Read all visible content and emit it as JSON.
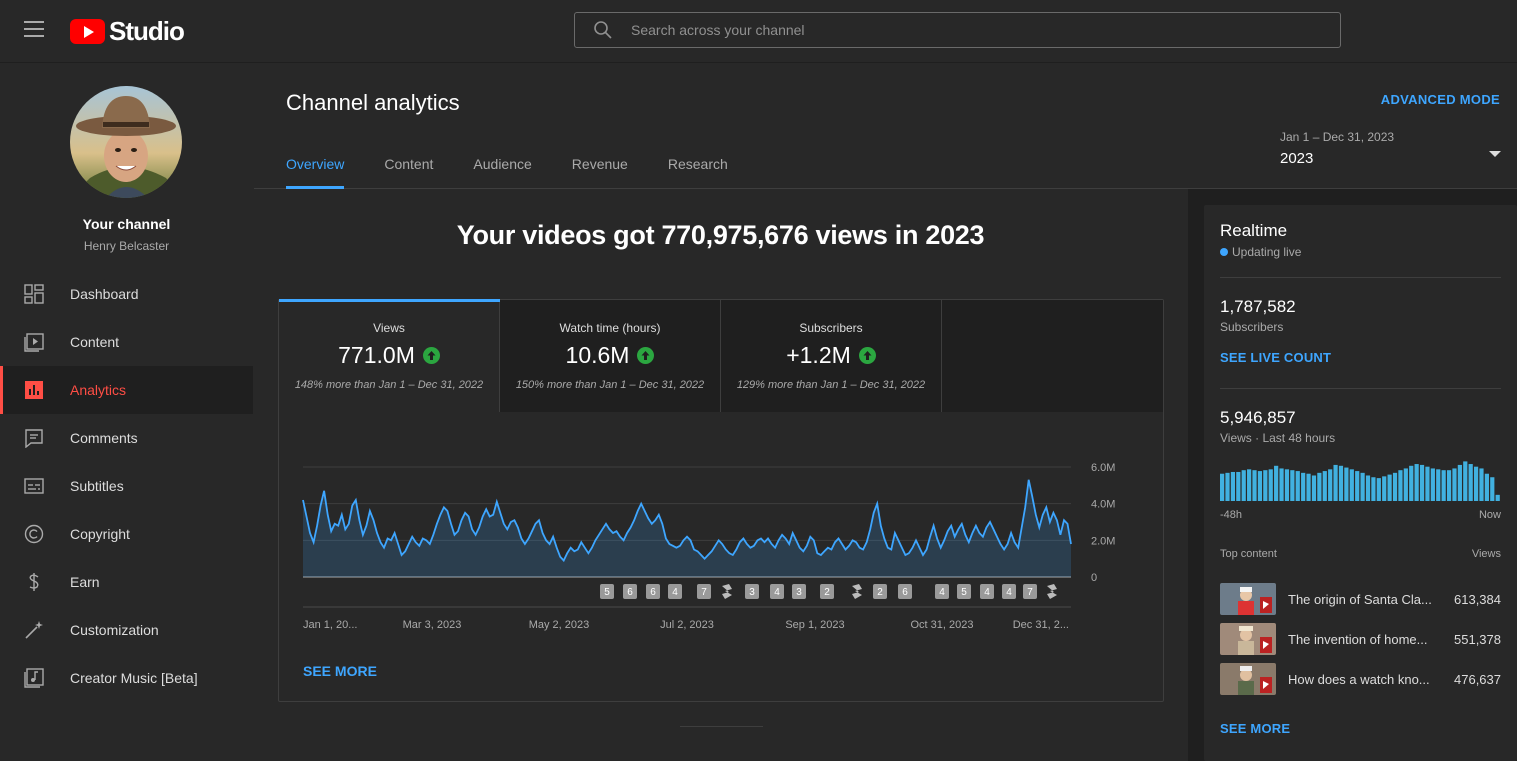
{
  "app": {
    "logo_text": "Studio",
    "brand_color": "#ff0000",
    "accent": "#3ea6ff"
  },
  "search": {
    "placeholder": "Search across your channel"
  },
  "channel": {
    "title": "Your channel",
    "name": "Henry Belcaster"
  },
  "sidebar": {
    "items": [
      {
        "label": "Dashboard",
        "icon": "dashboard-icon"
      },
      {
        "label": "Content",
        "icon": "content-icon"
      },
      {
        "label": "Analytics",
        "icon": "analytics-icon",
        "active": true
      },
      {
        "label": "Comments",
        "icon": "comments-icon"
      },
      {
        "label": "Subtitles",
        "icon": "subtitles-icon"
      },
      {
        "label": "Copyright",
        "icon": "copyright-icon"
      },
      {
        "label": "Earn",
        "icon": "dollar-icon"
      },
      {
        "label": "Customization",
        "icon": "magic-wand-icon"
      },
      {
        "label": "Creator Music [Beta]",
        "icon": "music-icon"
      }
    ]
  },
  "header": {
    "title": "Channel analytics",
    "advanced_mode": "ADVANCED MODE",
    "tabs": [
      "Overview",
      "Content",
      "Audience",
      "Revenue",
      "Research"
    ],
    "active_tab": "Overview",
    "date_range": "Jan 1 – Dec 31, 2023",
    "date_value": "2023"
  },
  "headline": "Your videos got 770,975,676 views in 2023",
  "metrics": [
    {
      "label": "Views",
      "value": "771.0M",
      "comparison": "148% more than Jan 1 – Dec 31, 2022"
    },
    {
      "label": "Watch time (hours)",
      "value": "10.6M",
      "comparison": "150% more than Jan 1 – Dec 31, 2022"
    },
    {
      "label": "Subscribers",
      "value": "+1.2M",
      "comparison": "129% more than Jan 1 – Dec 31, 2022"
    }
  ],
  "chart_data": {
    "type": "area",
    "title": "",
    "xlabel": "",
    "ylabel": "",
    "x_ticks": [
      "Jan 1, 20...",
      "Mar 3, 2023",
      "May 2, 2023",
      "Jul 2, 2023",
      "Sep 1, 2023",
      "Oct 31, 2023",
      "Dec 31, 2..."
    ],
    "y_ticks": [
      "6.0M",
      "4.0M",
      "2.0M",
      "0"
    ],
    "ylim": [
      0,
      6000000
    ],
    "grid": true,
    "series": [
      {
        "values_millions": [
          4.2,
          3.3,
          2.4,
          1.9,
          2.8,
          3.9,
          4.7,
          3.4,
          2.5,
          2.9,
          2.8,
          3.4,
          2.6,
          2.9,
          3.9,
          4.2,
          3.1,
          2.3,
          2.8,
          3.6,
          3.1,
          2.4,
          1.9,
          1.6,
          2.1,
          2.0,
          2.4,
          1.8,
          1.2,
          1.4,
          1.8,
          2.2,
          1.9,
          1.7,
          2.1,
          2.0,
          1.8,
          2.3,
          2.9,
          3.4,
          3.8,
          3.6,
          2.9,
          2.3,
          2.5,
          3.1,
          3.5,
          3.3,
          2.6,
          2.3,
          2.7,
          3.3,
          3.7,
          3.3,
          3.4,
          4.1,
          3.5,
          2.9,
          2.6,
          3.0,
          3.1,
          2.7,
          2.1,
          1.8,
          2.1,
          2.5,
          2.9,
          3.1,
          2.4,
          2.0,
          1.8,
          2.2,
          1.6,
          1.1,
          0.9,
          1.3,
          1.6,
          1.4,
          1.5,
          1.9,
          1.6,
          1.3,
          1.6,
          2.0,
          2.3,
          2.6,
          2.9,
          2.6,
          2.4,
          2.5,
          2.2,
          2.0,
          2.4,
          2.7,
          3.1,
          3.6,
          4.0,
          3.6,
          3.2,
          2.9,
          3.1,
          3.4,
          2.9,
          2.1,
          1.8,
          1.7,
          1.6,
          1.7,
          2.0,
          2.2,
          2.0,
          1.5,
          1.4,
          1.2,
          1.0,
          1.2,
          1.4,
          1.7,
          2.0,
          1.8,
          1.5,
          1.3,
          1.2,
          1.5,
          1.9,
          2.1,
          1.8,
          1.6,
          1.7,
          2.0,
          2.1,
          1.9,
          2.1,
          1.8,
          1.6,
          2.0,
          2.3,
          2.1,
          1.8,
          2.4,
          2.0,
          1.6,
          1.4,
          1.7,
          2.2,
          2.0,
          1.3,
          1.2,
          1.4,
          1.6,
          1.5,
          1.9,
          2.1,
          1.8,
          1.5,
          1.7,
          2.0,
          1.9,
          1.6,
          1.5,
          1.9,
          2.6,
          3.5,
          4.0,
          2.8,
          2.1,
          1.6,
          1.5,
          2.4,
          2.0,
          1.6,
          1.2,
          1.3,
          1.6,
          2.0,
          1.6,
          1.2,
          1.5,
          2.2,
          2.8,
          2.1,
          1.6,
          2.0,
          2.5,
          2.8,
          2.2,
          2.6,
          2.9,
          2.3,
          1.9,
          2.4,
          2.8,
          2.4,
          2.2,
          2.7,
          3.0,
          2.6,
          2.2,
          1.8,
          1.5,
          1.8,
          2.4,
          1.9,
          1.6,
          2.7,
          3.8,
          5.3,
          4.4,
          3.4,
          2.7,
          3.4,
          3.8,
          3.0,
          3.5,
          3.1,
          2.3,
          3.1,
          2.9,
          1.8
        ]
      }
    ],
    "color": "#3ea6ff",
    "video_markers": [
      "5",
      "6",
      "6",
      "4",
      "7",
      "shorts",
      "3",
      "4",
      "3",
      "2",
      "shorts",
      "2",
      "6",
      "4",
      "5",
      "4",
      "4",
      "7",
      "shorts"
    ]
  },
  "see_more": "SEE MORE",
  "realtime": {
    "title": "Realtime",
    "live_label": "Updating live",
    "subscribers_value": "1,787,582",
    "subscribers_label": "Subscribers",
    "see_live_count": "SEE LIVE COUNT",
    "views_value": "5,946,857",
    "views_label": "Views · Last 48 hours",
    "axis_start": "-48h",
    "axis_end": "Now",
    "bars": [
      0.62,
      0.64,
      0.66,
      0.66,
      0.7,
      0.72,
      0.7,
      0.68,
      0.7,
      0.72,
      0.8,
      0.74,
      0.72,
      0.7,
      0.68,
      0.64,
      0.62,
      0.58,
      0.64,
      0.68,
      0.72,
      0.82,
      0.8,
      0.76,
      0.72,
      0.68,
      0.64,
      0.58,
      0.54,
      0.52,
      0.56,
      0.6,
      0.64,
      0.7,
      0.74,
      0.8,
      0.84,
      0.82,
      0.78,
      0.74,
      0.72,
      0.7,
      0.7,
      0.74,
      0.82,
      0.9,
      0.84,
      0.78,
      0.74,
      0.62,
      0.54,
      0.14
    ],
    "top_content_label": "Top content",
    "views_col_label": "Views",
    "top_content": [
      {
        "title": "The origin of Santa Cla...",
        "views": "613,384"
      },
      {
        "title": "The invention of home...",
        "views": "551,378"
      },
      {
        "title": "How does a watch kno...",
        "views": "476,637"
      }
    ],
    "see_more": "SEE MORE"
  }
}
